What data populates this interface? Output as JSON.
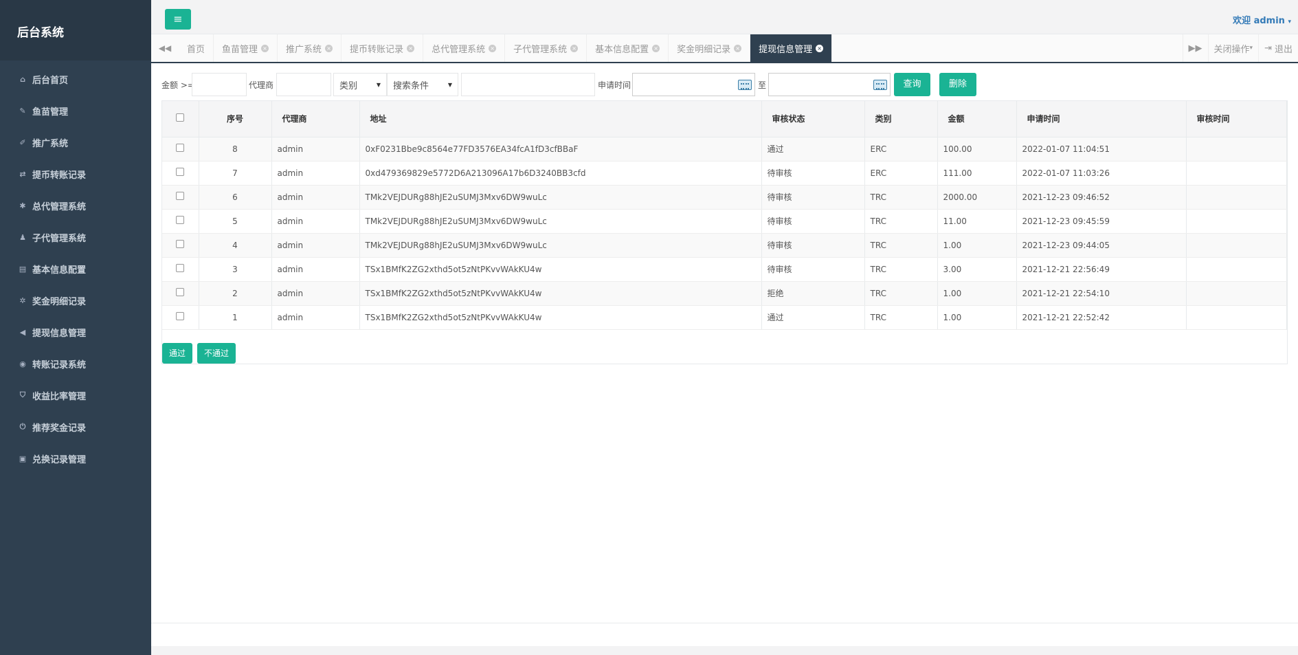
{
  "sidebar": {
    "title": "后台系统",
    "items": [
      {
        "label": "后台首页",
        "icon": "home-icon",
        "glyph": "⌂"
      },
      {
        "label": "鱼苗管理",
        "icon": "wrench-icon",
        "glyph": "✎"
      },
      {
        "label": "推广系统",
        "icon": "edit-icon",
        "glyph": "✐"
      },
      {
        "label": "提币转账记录",
        "icon": "shuffle-icon",
        "glyph": "⇄"
      },
      {
        "label": "总代管理系统",
        "icon": "asterisk-icon",
        "glyph": "✱"
      },
      {
        "label": "子代管理系统",
        "icon": "users-icon",
        "glyph": "♟"
      },
      {
        "label": "基本信息配置",
        "icon": "file-icon",
        "glyph": "▤"
      },
      {
        "label": "奖金明细记录",
        "icon": "gears-icon",
        "glyph": "✲"
      },
      {
        "label": "提现信息管理",
        "icon": "bullhorn-icon",
        "glyph": "◀"
      },
      {
        "label": "转账记录系统",
        "icon": "dashboard-icon",
        "glyph": "◉"
      },
      {
        "label": "收益比率管理",
        "icon": "shield-icon",
        "glyph": "⛉"
      },
      {
        "label": "推荐奖金记录",
        "icon": "power-icon",
        "glyph": "⏻"
      },
      {
        "label": "兑换记录管理",
        "icon": "save-icon",
        "glyph": "▣"
      }
    ]
  },
  "header": {
    "menu_toggle_glyph": "≡",
    "welcome": "欢迎 admin",
    "caret": "▾"
  },
  "tabs": {
    "scroll_left_glyph": "◀◀",
    "scroll_right_glyph": "▶▶",
    "close_glyph": "×",
    "items": [
      {
        "label": "首页",
        "closable": false
      },
      {
        "label": "鱼苗管理",
        "closable": true
      },
      {
        "label": "推广系统",
        "closable": true
      },
      {
        "label": "提币转账记录",
        "closable": true
      },
      {
        "label": "总代管理系统",
        "closable": true
      },
      {
        "label": "子代管理系统",
        "closable": true
      },
      {
        "label": "基本信息配置",
        "closable": true
      },
      {
        "label": "奖金明细记录",
        "closable": true
      },
      {
        "label": "提现信息管理",
        "closable": true,
        "active": true
      }
    ],
    "close_ops": "关闭操作",
    "caret": "▾",
    "logout": "退出",
    "logout_glyph": "⇥"
  },
  "filters": {
    "amount_label": "金额 >=",
    "amount_value": "",
    "agent_label": "代理商",
    "agent_value": "",
    "category_select": "类别",
    "search_cond_select": "搜索条件",
    "keyword_value": "",
    "apply_time_label": "申请时间",
    "start_date": "",
    "to_label": "至",
    "end_date": "",
    "query_button": "查询",
    "delete_button": "删除",
    "select_arrow": "▼"
  },
  "table": {
    "columns": [
      "",
      "序号",
      "代理商",
      "地址",
      "审核状态",
      "类别",
      "金额",
      "申请时间",
      "审核时间"
    ],
    "rows": [
      [
        "8",
        "admin",
        "0xF0231Bbe9c8564e77FD3576EA34fcA1fD3cfBBaF",
        "通过",
        "ERC",
        "100.00",
        "2022-01-07 11:04:51",
        ""
      ],
      [
        "7",
        "admin",
        "0xd479369829e5772D6A213096A17b6D3240BB3cfd",
        "待审核",
        "ERC",
        "111.00",
        "2022-01-07 11:03:26",
        ""
      ],
      [
        "6",
        "admin",
        "TMk2VEJDURg88hJE2uSUMJ3Mxv6DW9wuLc",
        "待审核",
        "TRC",
        "2000.00",
        "2021-12-23 09:46:52",
        ""
      ],
      [
        "5",
        "admin",
        "TMk2VEJDURg88hJE2uSUMJ3Mxv6DW9wuLc",
        "待审核",
        "TRC",
        "11.00",
        "2021-12-23 09:45:59",
        ""
      ],
      [
        "4",
        "admin",
        "TMk2VEJDURg88hJE2uSUMJ3Mxv6DW9wuLc",
        "待审核",
        "TRC",
        "1.00",
        "2021-12-23 09:44:05",
        ""
      ],
      [
        "3",
        "admin",
        "TSx1BMfK2ZG2xthd5ot5zNtPKvvWAkKU4w",
        "待审核",
        "TRC",
        "3.00",
        "2021-12-21 22:56:49",
        ""
      ],
      [
        "2",
        "admin",
        "TSx1BMfK2ZG2xthd5ot5zNtPKvvWAkKU4w",
        "拒绝",
        "TRC",
        "1.00",
        "2021-12-21 22:54:10",
        ""
      ],
      [
        "1",
        "admin",
        "TSx1BMfK2ZG2xthd5ot5zNtPKvvWAkKU4w",
        "通过",
        "TRC",
        "1.00",
        "2021-12-21 22:52:42",
        ""
      ]
    ]
  },
  "actions": {
    "approve_button": "通过",
    "reject_button": "不通过"
  },
  "colors": {
    "sidebar_bg": "#2f4050",
    "accent": "#1ab394",
    "link": "#337ab7"
  }
}
